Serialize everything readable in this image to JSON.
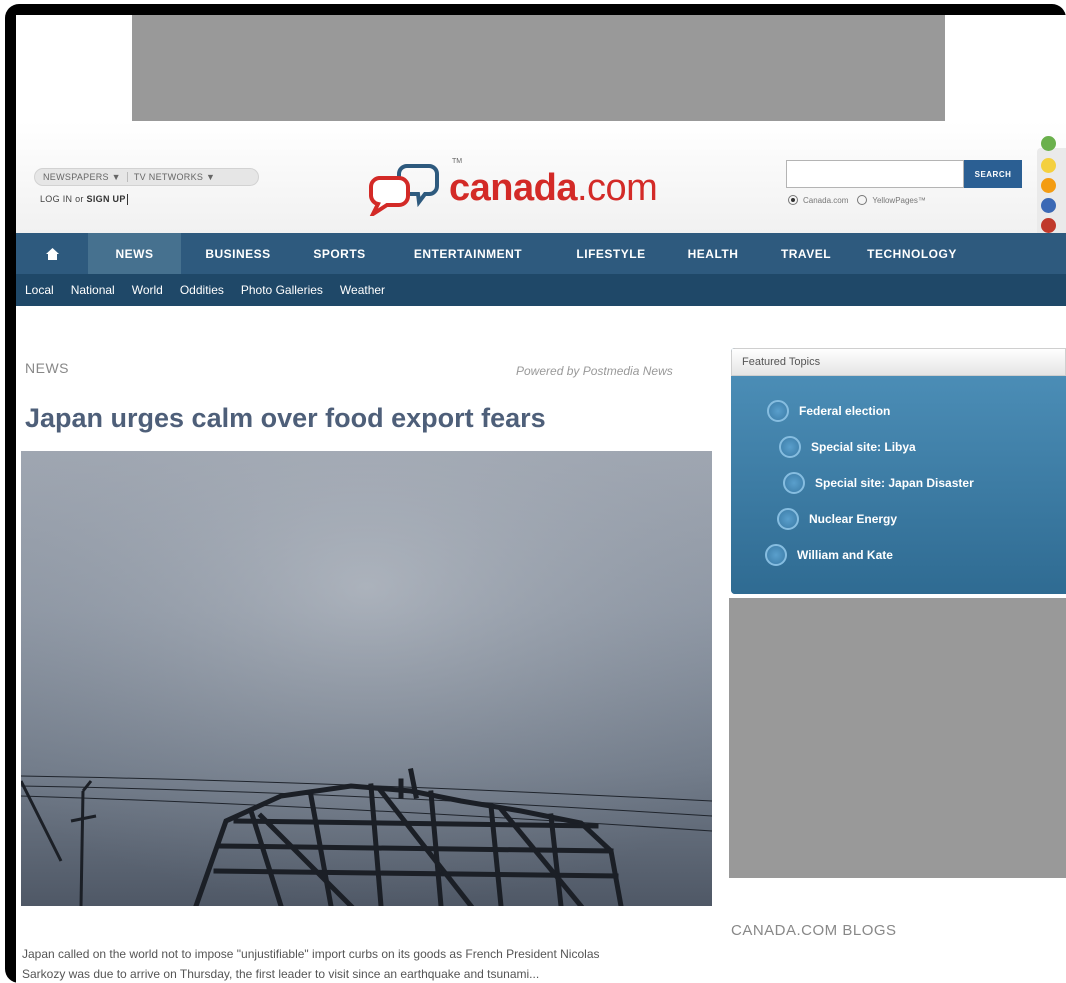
{
  "header": {
    "networks": [
      "NEWSPAPERS",
      "TV NETWORKS"
    ],
    "login_label": "LOG IN",
    "or_label": "or",
    "signup_label": "SIGN UP",
    "logo_brand": "canada",
    "logo_domain": ".com",
    "logo_tm": "TM",
    "search_button": "SEARCH",
    "search_options": [
      "Canada.com",
      "YellowPages™"
    ]
  },
  "nav": {
    "items": [
      "NEWS",
      "BUSINESS",
      "SPORTS",
      "ENTERTAINMENT",
      "LIFESTYLE",
      "HEALTH",
      "TRAVEL",
      "TECHNOLOGY"
    ]
  },
  "subnav": {
    "items": [
      "Local",
      "National",
      "World",
      "Oddities",
      "Photo Galleries",
      "Weather"
    ]
  },
  "article": {
    "section": "NEWS",
    "powered_by": "Powered by Postmedia News",
    "headline": "Japan urges calm over food export fears",
    "caption_line1": "Japan called on the world not to impose \"unjustifiable\" import curbs on its goods as French President Nicolas",
    "caption_line2": "Sarkozy was due to arrive on Thursday, the first leader to visit since an earthquake and tsunami..."
  },
  "sidebar": {
    "featured_title": "Featured Topics",
    "topics": [
      "Federal election",
      "Special site: Libya",
      "Special site: Japan Disaster",
      "Nuclear Energy",
      "William and Kate"
    ],
    "blogs_title": "CANADA.COM BLOGS"
  },
  "colors": {
    "brand_red": "#d32a27",
    "nav_blue": "#2e5a7e",
    "subnav_blue": "#1f4868",
    "featured_blue": "#3a7aa3"
  }
}
